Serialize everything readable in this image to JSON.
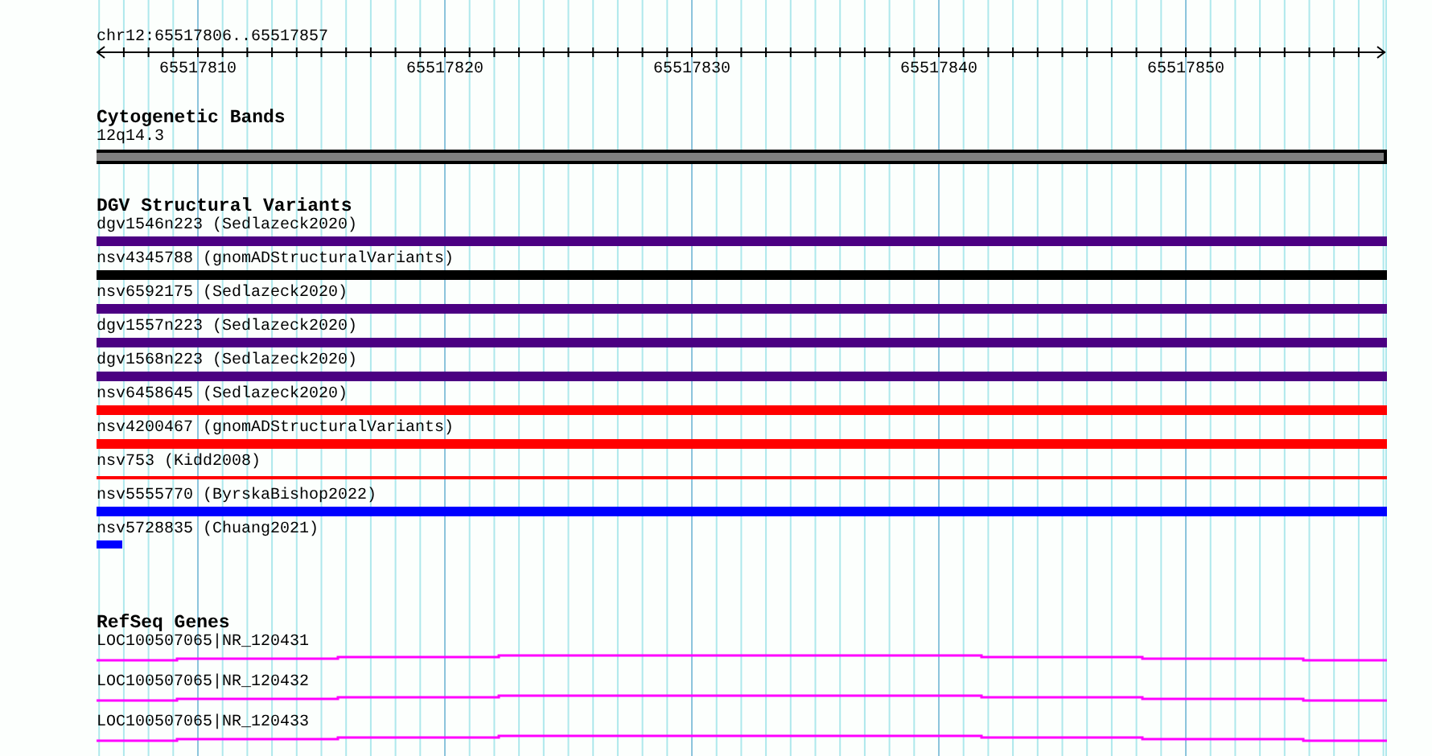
{
  "ruler": {
    "location": "chr12:65517806..65517857",
    "ticks": [
      "65517810",
      "65517820",
      "65517830",
      "65517840",
      "65517850"
    ]
  },
  "tracks": [
    {
      "kind": "cytoband",
      "title": "Cytogenetic Bands",
      "features": [
        {
          "label": "12q14.3"
        }
      ]
    },
    {
      "kind": "variants",
      "title": "DGV Structural Variants",
      "features": [
        {
          "label": "dgv1546n223 (Sedlazeck2020)",
          "kind": "bar",
          "color": "#4b0082"
        },
        {
          "label": "nsv4345788 (gnomADStructuralVariants)",
          "kind": "bar",
          "color": "#000000"
        },
        {
          "label": "nsv6592175 (Sedlazeck2020)",
          "kind": "bar",
          "color": "#4b0082"
        },
        {
          "label": "dgv1557n223 (Sedlazeck2020)",
          "kind": "bar",
          "color": "#4b0082"
        },
        {
          "label": "dgv1568n223 (Sedlazeck2020)",
          "kind": "bar",
          "color": "#4b0082"
        },
        {
          "label": "nsv6458645 (Sedlazeck2020)",
          "kind": "bar",
          "color": "#ff0000"
        },
        {
          "label": "nsv4200467 (gnomADStructuralVariants)",
          "kind": "bar",
          "color": "#ff0000"
        },
        {
          "label": "nsv753 (Kidd2008)",
          "kind": "line",
          "color": "#ff0000"
        },
        {
          "label": "nsv5555770 (ByrskaBishop2022)",
          "kind": "bar",
          "color": "#0000ff"
        },
        {
          "label": "nsv5728835 (Chuang2021)",
          "kind": "stub",
          "color": "#0000ff"
        }
      ]
    },
    {
      "kind": "genes",
      "title": "RefSeq Genes",
      "features": [
        {
          "label": "LOC100507065|NR_120431"
        },
        {
          "label": "LOC100507065|NR_120432"
        },
        {
          "label": "LOC100507065|NR_120433"
        }
      ]
    }
  ]
}
